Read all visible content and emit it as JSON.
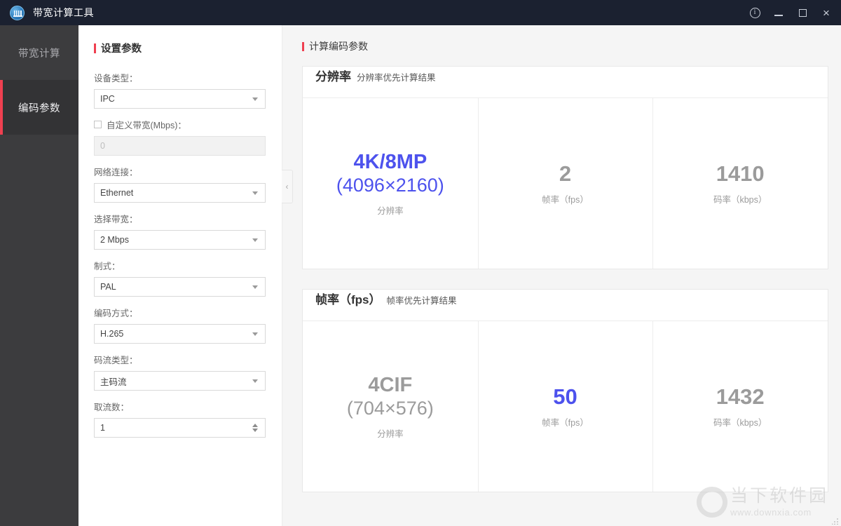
{
  "titlebar": {
    "app_name": "带宽计算工具",
    "logo_icon": "bandwidth-app-icon",
    "info_label": "i",
    "close_label": "×",
    "buttons": {
      "info": "info-icon",
      "minimize": "minimize-icon",
      "maximize": "maximize-icon",
      "close": "close-icon"
    }
  },
  "sidebar": {
    "items": [
      {
        "label": "带宽计算",
        "active": false
      },
      {
        "label": "编码参数",
        "active": true
      }
    ],
    "accent_color": "#ef4050",
    "background": "#3c3c3e"
  },
  "form": {
    "section_title": "设置参数",
    "fields": [
      {
        "label": "设备类型：",
        "value": "IPC",
        "type": "select"
      },
      {
        "label": "自定义带宽(Mbps)：",
        "value": "",
        "placeholder": "0",
        "type": "checkbox-input",
        "checked": false,
        "disabled": true
      },
      {
        "label": "网络连接：",
        "value": "Ethernet",
        "type": "select"
      },
      {
        "label": "选择带宽：",
        "value": "2 Mbps",
        "type": "select"
      },
      {
        "label": "制式：",
        "value": "PAL",
        "type": "select"
      },
      {
        "label": "编码方式：",
        "value": "H.265",
        "type": "select"
      },
      {
        "label": "码流类型：",
        "value": "主码流",
        "type": "select"
      },
      {
        "label": "取流数：",
        "value": "1",
        "type": "spinner"
      }
    ],
    "collapse_handle": "‹"
  },
  "results": {
    "header": "计算编码参数",
    "cards": [
      {
        "title": "分辨率",
        "subtitle": "分辨率优先计算结果",
        "cells": [
          {
            "value": "4K/8MP",
            "value_paren": "(4096×2160)",
            "caption": "分辨率",
            "highlight": true
          },
          {
            "value": "2",
            "caption": "帧率（fps）",
            "highlight": false
          },
          {
            "value": "1410",
            "caption": "码率（kbps）",
            "highlight": false
          }
        ]
      },
      {
        "title": "帧率（fps）",
        "subtitle": "帧率优先计算结果",
        "cells": [
          {
            "value": "4CIF",
            "value_paren": "(704×576)",
            "caption": "分辨率",
            "highlight": false
          },
          {
            "value": "50",
            "caption": "帧率（fps）",
            "highlight": true
          },
          {
            "value": "1432",
            "caption": "码率（kbps）",
            "highlight": false
          }
        ]
      }
    ],
    "highlight_color": "#4d52ed",
    "muted_color": "#9b9b9b"
  },
  "watermark": {
    "logo_icon": "downxia-o-logo",
    "name": "当下软件园",
    "url": "www.downxia.com"
  }
}
